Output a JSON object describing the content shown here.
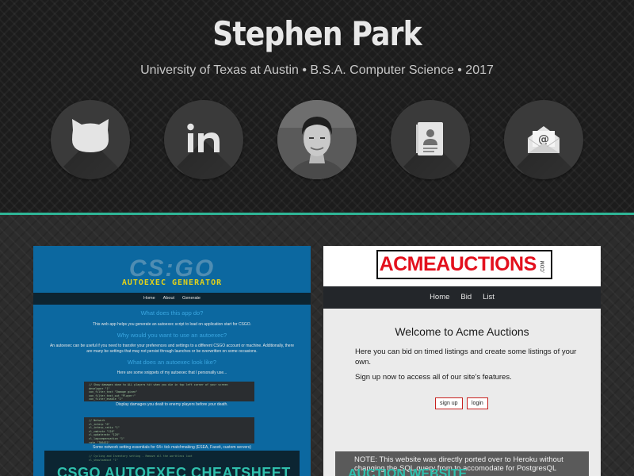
{
  "header": {
    "name": "Stephen Park",
    "subtitle": "University of Texas at Austin • B.S.A. Computer Science • 2017",
    "social": [
      {
        "icon": "github-icon",
        "label": "GitHub"
      },
      {
        "icon": "linkedin-icon",
        "label": "LinkedIn"
      },
      {
        "icon": "profile-photo",
        "label": "Photo"
      },
      {
        "icon": "resume-icon",
        "label": "Resume"
      },
      {
        "icon": "email-icon",
        "label": "Email"
      }
    ],
    "accent_color": "#2fb596"
  },
  "projects": {
    "csgo": {
      "logo": "CS:GO",
      "heading": "AUTOEXEC GENERATOR",
      "nav": [
        "Home",
        "About",
        "Generate"
      ],
      "q1": "What does this app do?",
      "a1": "This web app helps you generate an autoexec script to load on application start for CSGO.",
      "q2": "Why would you want to use an autoexec?",
      "a2": "An autoexec can be useful if you need to transfer your preferences and settings to a different CSGO account or machine. Additionally, there are many be settings that may not persist through launches or be overwritten on some occasions.",
      "q3": "What does an autoexec look like?",
      "a3": "Here are some snippets of my autoexec that I personally use...",
      "code1": "// Show damages done to ALL players hit when you die in top left corner of your screen\ndeveloper \"1\"\ncon_filter_text \"Damage given\"\ncon_filter_text_out \"Player:\"\ncon_filter_enable \"2\"",
      "caption1": "Display damages you dealt to enemy players before your death.",
      "code2": "// Network\ncl_interp \"0\"\ncl_interp_ratio \"1\"\ncl_cmdrate \"128\"\ncl_updaterate \"128\"\ncl_lagcompensation \"1\"\nrate \"786432\"",
      "caption2": "Some network setting essentials for 64+ tick matchmaking (ESEA, Faceit, custom servers)",
      "code3": "// Cycling and Inventory setting - Remove all the worthless loot\ncl_showloadout \"1\"",
      "footer": "CSGO AUTOEXEC CHEATSHEET",
      "color": "#0c68a0"
    },
    "acme": {
      "logo": "ACMEAUCTIONS",
      "logo_suffix": ".COM",
      "nav": [
        "Home",
        "Bid",
        "List"
      ],
      "welcome": "Welcome to Acme Auctions",
      "p1": "Here you can bid on timed listings and create some listings of your own.",
      "p2": "Sign up now to access all of our site's features.",
      "signup": "sign up",
      "login": "login",
      "note": "NOTE: This website was directly ported over to Heroku without changing the SQL query from to accomodate for PostgresQL",
      "footer": "AUCTION WEBSITE",
      "brand_color": "#e3101d"
    }
  }
}
